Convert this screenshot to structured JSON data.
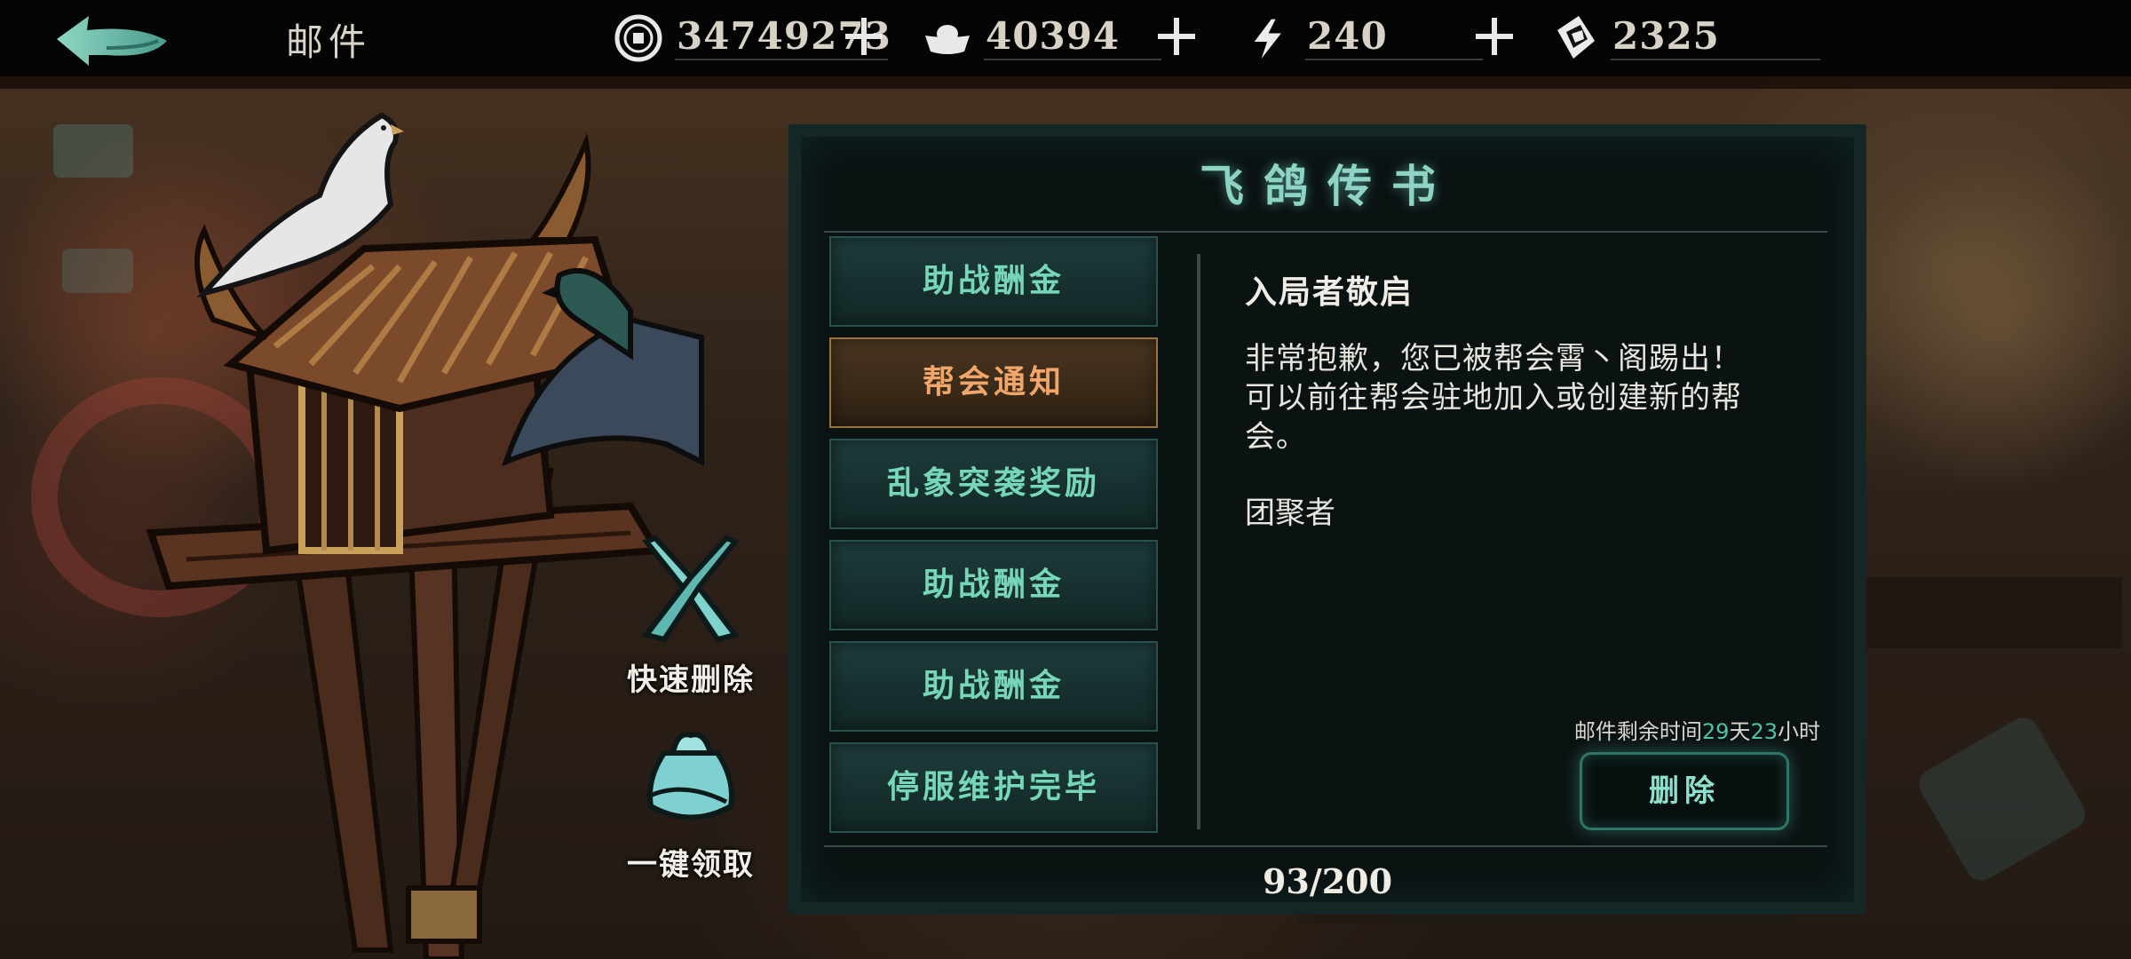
{
  "header": {
    "title": "邮件",
    "resources": [
      {
        "icon": "copper-coin-icon",
        "amount": "34749273"
      },
      {
        "icon": "silver-ingot-icon",
        "amount": "40394"
      },
      {
        "icon": "lightning-energy-icon",
        "amount": "240"
      },
      {
        "icon": "ticket-voucher-icon",
        "amount": "2325"
      }
    ]
  },
  "side_actions": {
    "quick_delete": "快速删除",
    "claim_all": "一键领取"
  },
  "panel": {
    "title": "飞鸽传书",
    "mail_items": [
      {
        "label": "助战酬金",
        "selected": false
      },
      {
        "label": "帮会通知",
        "selected": true
      },
      {
        "label": "乱象突袭奖励",
        "selected": false
      },
      {
        "label": "助战酬金",
        "selected": false
      },
      {
        "label": "助战酬金",
        "selected": false
      },
      {
        "label": "停服维护完毕",
        "selected": false
      }
    ],
    "mail": {
      "heading": "入局者敬启",
      "body": "非常抱歉，您已被帮会霄丶阁踢出！\n可以前往帮会驻地加入或创建新的帮\n会。",
      "signature": "团聚者"
    },
    "expiry": {
      "prefix": "邮件剩余时间",
      "days": "29",
      "days_unit": "天",
      "hours": "23",
      "hours_unit": "小时"
    },
    "delete_label": "删除",
    "count": "93/200"
  },
  "colors": {
    "accent_teal": "#76d6b8",
    "selected_orange": "#f0a56a",
    "panel_bg": "#0b1212"
  }
}
